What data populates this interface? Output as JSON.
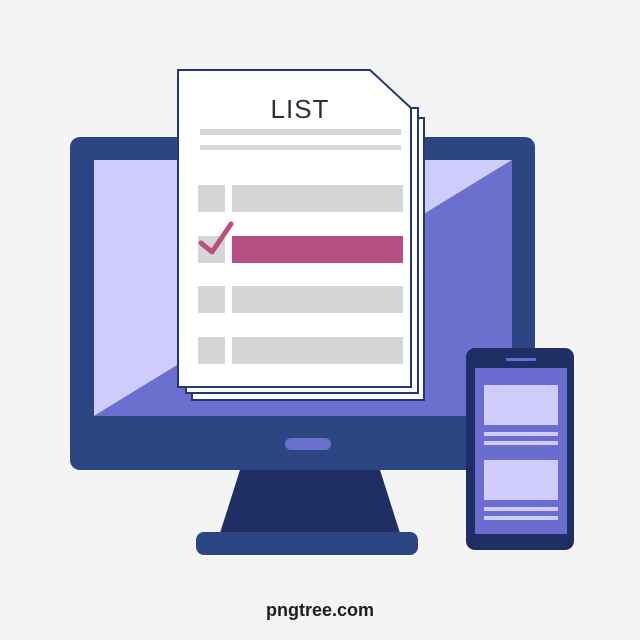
{
  "document": {
    "title": "LIST",
    "rows": [
      {
        "checked": false
      },
      {
        "checked": true
      },
      {
        "checked": false
      },
      {
        "checked": false
      }
    ]
  },
  "watermark": "pngtree.com",
  "colors": {
    "background": "#f4f4f4",
    "monitor_frame": "#2b4682",
    "monitor_screen_light": "#cfcbfb",
    "monitor_screen_dark": "#6b70cf",
    "monitor_stand": "#1f2f63",
    "paper": "#ffffff",
    "paper_outline": "#243772",
    "placeholder_gray": "#d6d6d6",
    "highlight": "#b84f83",
    "phone_body": "#1e2f66",
    "phone_screen": "#6b6ccf",
    "phone_card": "#cfcbfb"
  },
  "icons": [
    "desktop-monitor-icon",
    "checklist-document-icon",
    "checkmark-icon",
    "smartphone-icon"
  ]
}
